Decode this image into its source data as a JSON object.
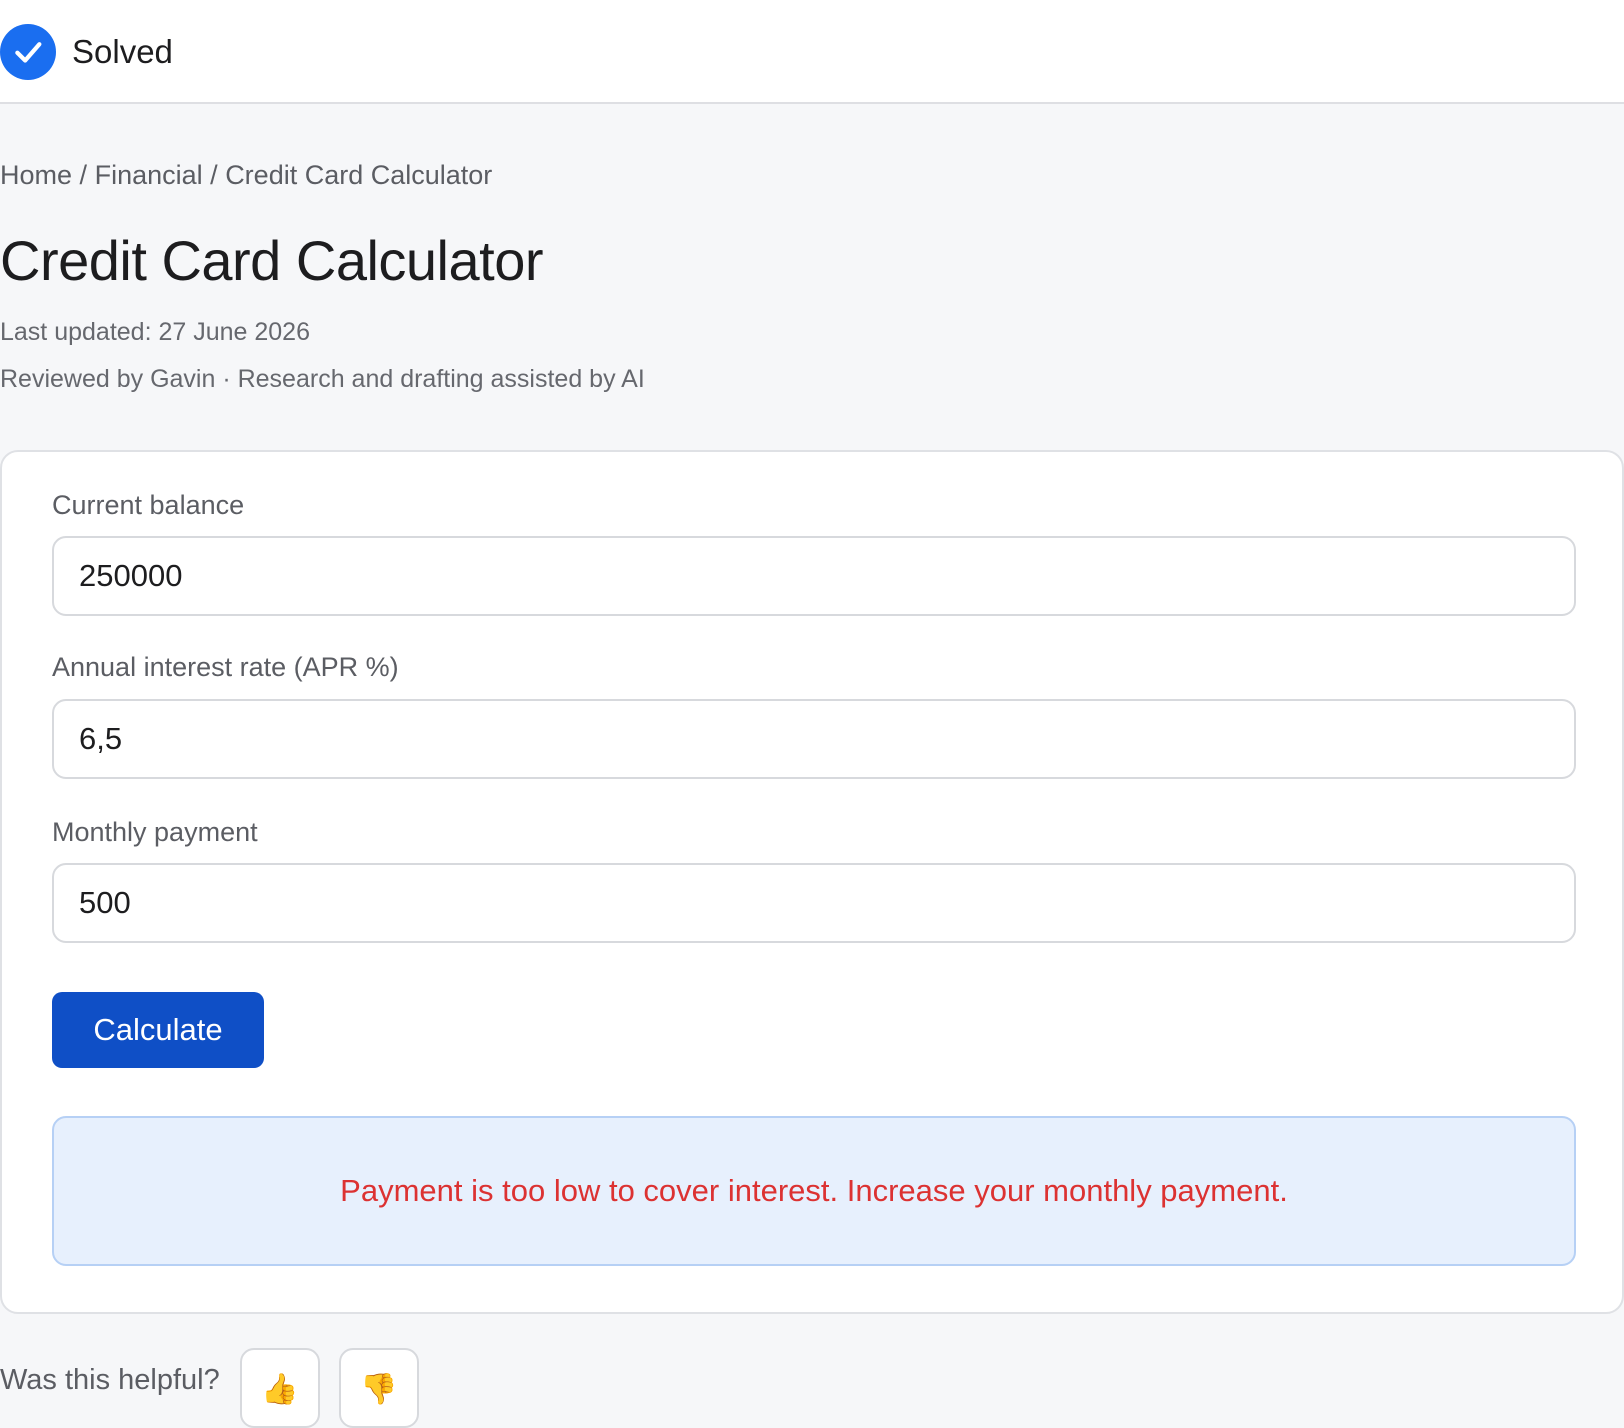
{
  "header": {
    "status_label": "Solved"
  },
  "breadcrumb": {
    "items": [
      "Home",
      "Financial",
      "Credit Card Calculator"
    ],
    "separator": "/"
  },
  "page": {
    "title": "Credit Card Calculator",
    "last_updated": "Last updated: 27 June 2026",
    "reviewed": "Reviewed by Gavin · Research and drafting assisted by AI"
  },
  "form": {
    "balance_label": "Current balance",
    "balance_value": "250000",
    "rate_label": "Annual interest rate (APR %)",
    "rate_value": "6,5",
    "payment_label": "Monthly payment",
    "payment_value": "500",
    "calculate_label": "Calculate"
  },
  "result": {
    "message": "Payment is too low to cover interest. Increase your monthly payment."
  },
  "feedback": {
    "question": "Was this helpful?",
    "thumbs_up": "👍",
    "thumbs_down": "👎"
  },
  "colors": {
    "accent": "#1a6ef0",
    "button": "#0f4fc6",
    "error_text": "#dc3232",
    "result_bg": "#e7f0fd"
  },
  "icons": {
    "status": "check-circle-icon",
    "helpful_yes": "thumbs-up-icon",
    "helpful_no": "thumbs-down-icon"
  }
}
